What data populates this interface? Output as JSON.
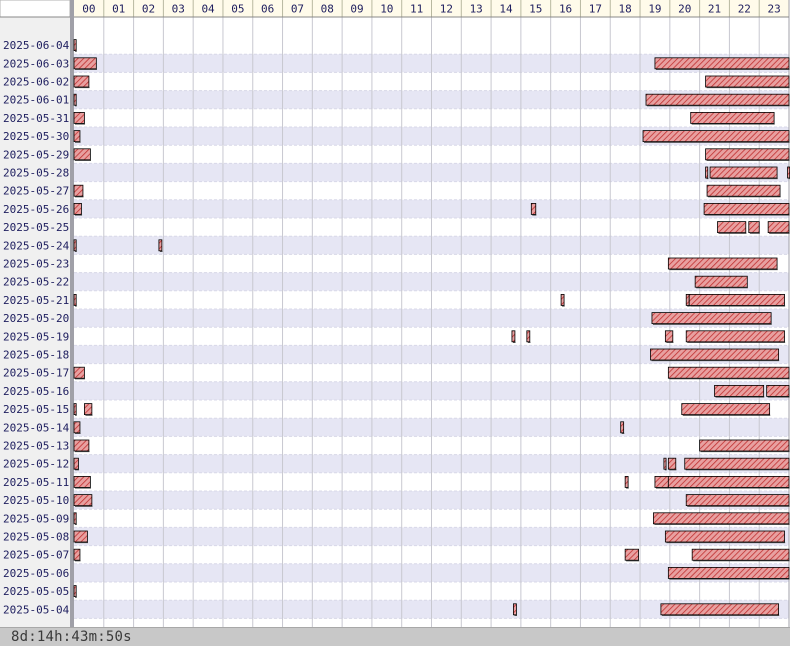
{
  "chart_data": {
    "type": "timeline",
    "title": "",
    "xlabel": "",
    "ylabel": "",
    "x_unit": "hour of day",
    "xlim": [
      0,
      24
    ],
    "hour_labels": [
      "00",
      "01",
      "02",
      "03",
      "04",
      "05",
      "06",
      "07",
      "08",
      "09",
      "10",
      "11",
      "12",
      "13",
      "14",
      "15",
      "16",
      "17",
      "18",
      "19",
      "20",
      "21",
      "22",
      "23"
    ],
    "grid": true,
    "colors": {
      "bar_fill": "#e8a0a0",
      "bar_hatch": "#c03030",
      "bar_border": "#000000",
      "row_band": "#e6e6f4",
      "row_plain": "#ffffff",
      "header_bg": "#fffbea",
      "sidebar_bg": "#f0f0f0",
      "footer_bg": "#c8c8c8"
    },
    "rows": [
      {
        "date": "2025-06-04",
        "intervals": [
          [
            0.0,
            0.07
          ]
        ]
      },
      {
        "date": "2025-06-03",
        "intervals": [
          [
            0.0,
            0.75
          ],
          [
            19.5,
            24.0
          ]
        ]
      },
      {
        "date": "2025-06-02",
        "intervals": [
          [
            0.0,
            0.5
          ],
          [
            21.2,
            24.0
          ]
        ]
      },
      {
        "date": "2025-06-01",
        "intervals": [
          [
            0.0,
            0.05
          ],
          [
            19.2,
            24.0
          ]
        ]
      },
      {
        "date": "2025-05-31",
        "intervals": [
          [
            0.0,
            0.35
          ],
          [
            20.7,
            23.5
          ]
        ]
      },
      {
        "date": "2025-05-30",
        "intervals": [
          [
            0.0,
            0.2
          ],
          [
            19.1,
            24.0
          ]
        ]
      },
      {
        "date": "2025-05-29",
        "intervals": [
          [
            0.0,
            0.55
          ],
          [
            21.2,
            24.0
          ]
        ]
      },
      {
        "date": "2025-05-28",
        "intervals": [
          [
            21.2,
            21.25
          ],
          [
            21.35,
            23.6
          ],
          [
            23.95,
            24.0
          ]
        ]
      },
      {
        "date": "2025-05-27",
        "intervals": [
          [
            0.0,
            0.3
          ],
          [
            21.25,
            23.7
          ]
        ]
      },
      {
        "date": "2025-05-26",
        "intervals": [
          [
            0.0,
            0.25
          ],
          [
            15.35,
            15.5
          ],
          [
            21.15,
            24.0
          ]
        ]
      },
      {
        "date": "2025-05-25",
        "intervals": [
          [
            21.6,
            22.55
          ],
          [
            22.65,
            23.0
          ],
          [
            23.3,
            24.0
          ]
        ]
      },
      {
        "date": "2025-05-24",
        "intervals": [
          [
            0.0,
            0.05
          ],
          [
            2.85,
            2.95
          ]
        ]
      },
      {
        "date": "2025-05-23",
        "intervals": [
          [
            19.95,
            23.6
          ]
        ]
      },
      {
        "date": "2025-05-22",
        "intervals": [
          [
            20.85,
            22.6
          ]
        ]
      },
      {
        "date": "2025-05-21",
        "intervals": [
          [
            0.0,
            0.05
          ],
          [
            16.35,
            16.45
          ],
          [
            20.55,
            20.65
          ],
          [
            20.65,
            23.85
          ]
        ]
      },
      {
        "date": "2025-05-20",
        "intervals": [
          [
            19.4,
            23.4
          ]
        ]
      },
      {
        "date": "2025-05-19",
        "intervals": [
          [
            14.7,
            14.8
          ],
          [
            15.2,
            15.3
          ],
          [
            19.85,
            20.1
          ],
          [
            20.55,
            23.85
          ]
        ]
      },
      {
        "date": "2025-05-18",
        "intervals": [
          [
            19.35,
            23.65
          ]
        ]
      },
      {
        "date": "2025-05-17",
        "intervals": [
          [
            0.0,
            0.35
          ],
          [
            19.95,
            24.0
          ]
        ]
      },
      {
        "date": "2025-05-16",
        "intervals": [
          [
            21.5,
            23.15
          ],
          [
            23.25,
            24.0
          ]
        ]
      },
      {
        "date": "2025-05-15",
        "intervals": [
          [
            0.0,
            0.05
          ],
          [
            0.35,
            0.6
          ],
          [
            20.4,
            23.35
          ]
        ]
      },
      {
        "date": "2025-05-14",
        "intervals": [
          [
            0.0,
            0.2
          ],
          [
            18.35,
            18.45
          ]
        ]
      },
      {
        "date": "2025-05-13",
        "intervals": [
          [
            0.0,
            0.5
          ],
          [
            21.0,
            24.0
          ]
        ]
      },
      {
        "date": "2025-05-12",
        "intervals": [
          [
            0.0,
            0.15
          ],
          [
            19.8,
            19.85
          ],
          [
            19.95,
            20.2
          ],
          [
            20.5,
            24.0
          ]
        ]
      },
      {
        "date": "2025-05-11",
        "intervals": [
          [
            0.0,
            0.55
          ],
          [
            18.5,
            18.6
          ],
          [
            19.5,
            19.95
          ],
          [
            19.95,
            24.0
          ]
        ]
      },
      {
        "date": "2025-05-10",
        "intervals": [
          [
            0.0,
            0.6
          ],
          [
            20.55,
            24.0
          ]
        ]
      },
      {
        "date": "2025-05-09",
        "intervals": [
          [
            0.0,
            0.05
          ],
          [
            19.45,
            24.0
          ]
        ]
      },
      {
        "date": "2025-05-08",
        "intervals": [
          [
            0.0,
            0.45
          ],
          [
            19.85,
            23.85
          ]
        ]
      },
      {
        "date": "2025-05-07",
        "intervals": [
          [
            0.0,
            0.2
          ],
          [
            18.5,
            18.95
          ],
          [
            20.75,
            24.0
          ]
        ]
      },
      {
        "date": "2025-05-06",
        "intervals": [
          [
            19.95,
            24.0
          ]
        ]
      },
      {
        "date": "2025-05-05",
        "intervals": [
          [
            0.0,
            0.05
          ]
        ]
      },
      {
        "date": "2025-05-04",
        "intervals": [
          [
            14.75,
            14.85
          ],
          [
            19.7,
            23.65
          ]
        ]
      }
    ]
  },
  "footer": {
    "total_duration": "8d:14h:43m:50s"
  }
}
